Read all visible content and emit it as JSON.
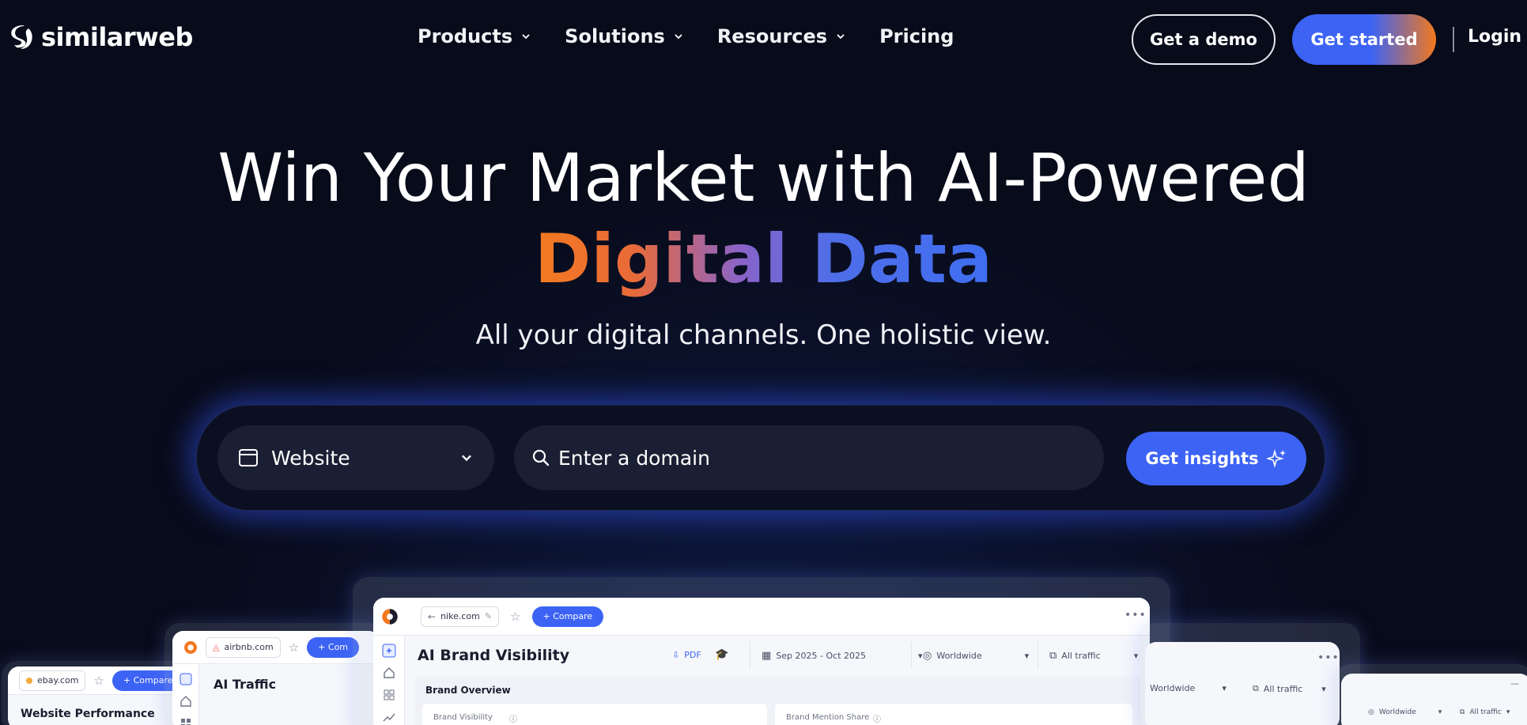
{
  "brand": {
    "name": "similarweb",
    "logo_icon": "similarweb-logo-icon"
  },
  "nav": {
    "links": [
      {
        "label": "Products",
        "has_menu": true
      },
      {
        "label": "Solutions",
        "has_menu": true
      },
      {
        "label": "Resources",
        "has_menu": true
      },
      {
        "label": "Pricing",
        "has_menu": false
      }
    ],
    "demo_label": "Get a demo",
    "start_label": "Get started",
    "login_label": "Login"
  },
  "hero": {
    "title": "Win Your Market with AI-Powered",
    "accent": "Digital Data",
    "subtitle": "All your digital channels. One holistic view."
  },
  "search": {
    "type_label": "Website",
    "type_icon": "browser-window-icon",
    "placeholder": "Enter a domain",
    "button_label": "Get insights",
    "button_icon": "sparkle-icon"
  },
  "preview": {
    "main": {
      "domain": "nike.com",
      "compare_label": "+ Compare",
      "title": "AI Brand Visibility",
      "pdf_label": "PDF",
      "date_range": "Sep 2025 - Oct 2025",
      "region": "Worldwide",
      "traffic": "All traffic",
      "section": "Brand Overview",
      "metric_left": "Brand Visibility",
      "metric_right": "Brand Mention Share"
    },
    "left": {
      "domain": "airbnb.com",
      "compare_label": "+ Com",
      "title": "AI Traffic"
    },
    "far_left": {
      "domain": "ebay.com",
      "compare_label": "+ Compare",
      "title": "Website Performance"
    },
    "right": {
      "region": "Worldwide",
      "traffic": "All traffic"
    },
    "far_right": {
      "region": "Worldwide",
      "traffic": "All traffic"
    }
  },
  "colors": {
    "background": "#080b1a",
    "primary_blue": "#3c63f4",
    "accent_orange": "#f2781e"
  }
}
